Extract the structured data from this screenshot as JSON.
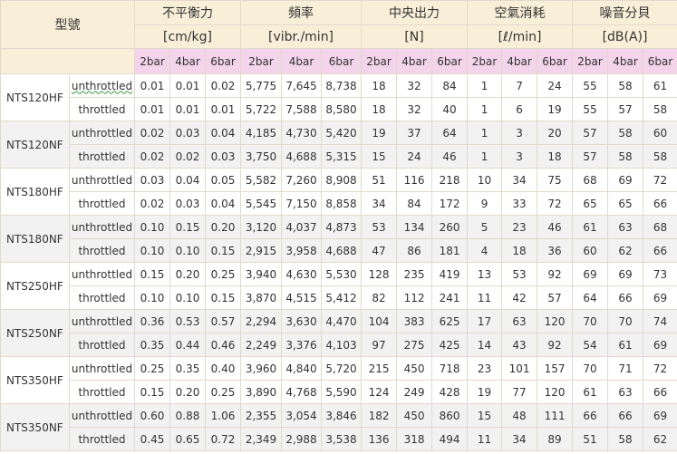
{
  "header": {
    "model_label": "型號",
    "groups": [
      {
        "title": "不平衡力",
        "unit": "[cm/kg]"
      },
      {
        "title": "頻率",
        "unit": "[vibr./min]"
      },
      {
        "title": "中央出力",
        "unit": "[N]"
      },
      {
        "title": "空氣消耗",
        "unit": "[ℓ/min]"
      },
      {
        "title": "噪音分貝",
        "unit": "[dB(A)]"
      }
    ],
    "pressures": [
      "2bar",
      "4bar",
      "6bar"
    ]
  },
  "rows": [
    {
      "model": "NTS120HF",
      "kind": "unthrottled",
      "values": [
        "0.01",
        "0.01",
        "0.02",
        "5,775",
        "7,645",
        "8,738",
        "18",
        "32",
        "84",
        "1",
        "7",
        "24",
        "55",
        "58",
        "61"
      ]
    },
    {
      "model": "",
      "kind": "throttled",
      "values": [
        "0.01",
        "0.01",
        "0.01",
        "5,722",
        "7,588",
        "8,580",
        "18",
        "32",
        "40",
        "1",
        "6",
        "19",
        "55",
        "57",
        "58"
      ]
    },
    {
      "model": "NTS120NF",
      "kind": "unthrottled",
      "values": [
        "0.02",
        "0.03",
        "0.04",
        "4,185",
        "4,730",
        "5,420",
        "19",
        "37",
        "64",
        "1",
        "3",
        "20",
        "57",
        "58",
        "60"
      ]
    },
    {
      "model": "",
      "kind": "throttled",
      "values": [
        "0.02",
        "0.02",
        "0.03",
        "3,750",
        "4,688",
        "5,315",
        "15",
        "24",
        "46",
        "1",
        "3",
        "18",
        "57",
        "58",
        "58"
      ]
    },
    {
      "model": "NTS180HF",
      "kind": "unthrottled",
      "values": [
        "0.03",
        "0.04",
        "0.05",
        "5,582",
        "7,260",
        "8,908",
        "51",
        "116",
        "218",
        "10",
        "34",
        "75",
        "68",
        "69",
        "72"
      ]
    },
    {
      "model": "",
      "kind": "throttled",
      "values": [
        "0.02",
        "0.03",
        "0.04",
        "5,545",
        "7,150",
        "8,858",
        "34",
        "84",
        "172",
        "9",
        "33",
        "72",
        "65",
        "65",
        "66"
      ]
    },
    {
      "model": "NTS180NF",
      "kind": "unthrottled",
      "values": [
        "0.10",
        "0.15",
        "0.20",
        "3,120",
        "4,037",
        "4,873",
        "53",
        "134",
        "260",
        "5",
        "23",
        "46",
        "61",
        "63",
        "68"
      ]
    },
    {
      "model": "",
      "kind": "throttled",
      "values": [
        "0.10",
        "0.10",
        "0.15",
        "2,915",
        "3,958",
        "4,688",
        "47",
        "86",
        "181",
        "4",
        "18",
        "36",
        "60",
        "62",
        "66"
      ]
    },
    {
      "model": "NTS250HF",
      "kind": "unthrottled",
      "values": [
        "0.15",
        "0.20",
        "0.25",
        "3,940",
        "4,630",
        "5,530",
        "128",
        "235",
        "419",
        "13",
        "53",
        "92",
        "69",
        "69",
        "73"
      ]
    },
    {
      "model": "",
      "kind": "throttled",
      "values": [
        "0.10",
        "0.10",
        "0.15",
        "3,870",
        "4,515",
        "5,412",
        "82",
        "112",
        "241",
        "11",
        "42",
        "57",
        "64",
        "66",
        "69"
      ]
    },
    {
      "model": "NTS250NF",
      "kind": "unthrottled",
      "values": [
        "0.36",
        "0.53",
        "0.57",
        "2,294",
        "3,630",
        "4,470",
        "104",
        "383",
        "625",
        "17",
        "63",
        "120",
        "70",
        "70",
        "74"
      ]
    },
    {
      "model": "",
      "kind": "throttled",
      "values": [
        "0.35",
        "0.44",
        "0.46",
        "2,249",
        "3,376",
        "4,103",
        "97",
        "275",
        "425",
        "14",
        "43",
        "92",
        "54",
        "61",
        "69"
      ]
    },
    {
      "model": "NTS350HF",
      "kind": "unthrottled",
      "values": [
        "0.25",
        "0.35",
        "0.40",
        "3,960",
        "4,840",
        "5,720",
        "215",
        "450",
        "718",
        "23",
        "101",
        "157",
        "70",
        "71",
        "72"
      ]
    },
    {
      "model": "",
      "kind": "throttled",
      "values": [
        "0.15",
        "0.20",
        "0.25",
        "3,890",
        "4,768",
        "5,590",
        "124",
        "249",
        "428",
        "19",
        "77",
        "120",
        "61",
        "63",
        "66"
      ]
    },
    {
      "model": "NTS350NF",
      "kind": "unthrottled",
      "values": [
        "0.60",
        "0.88",
        "1.06",
        "2,355",
        "3,054",
        "3,846",
        "182",
        "450",
        "860",
        "15",
        "48",
        "111",
        "66",
        "66",
        "69"
      ]
    },
    {
      "model": "",
      "kind": "throttled",
      "values": [
        "0.45",
        "0.65",
        "0.72",
        "2,349",
        "2,988",
        "3,538",
        "136",
        "318",
        "494",
        "11",
        "34",
        "89",
        "51",
        "58",
        "62"
      ]
    }
  ]
}
